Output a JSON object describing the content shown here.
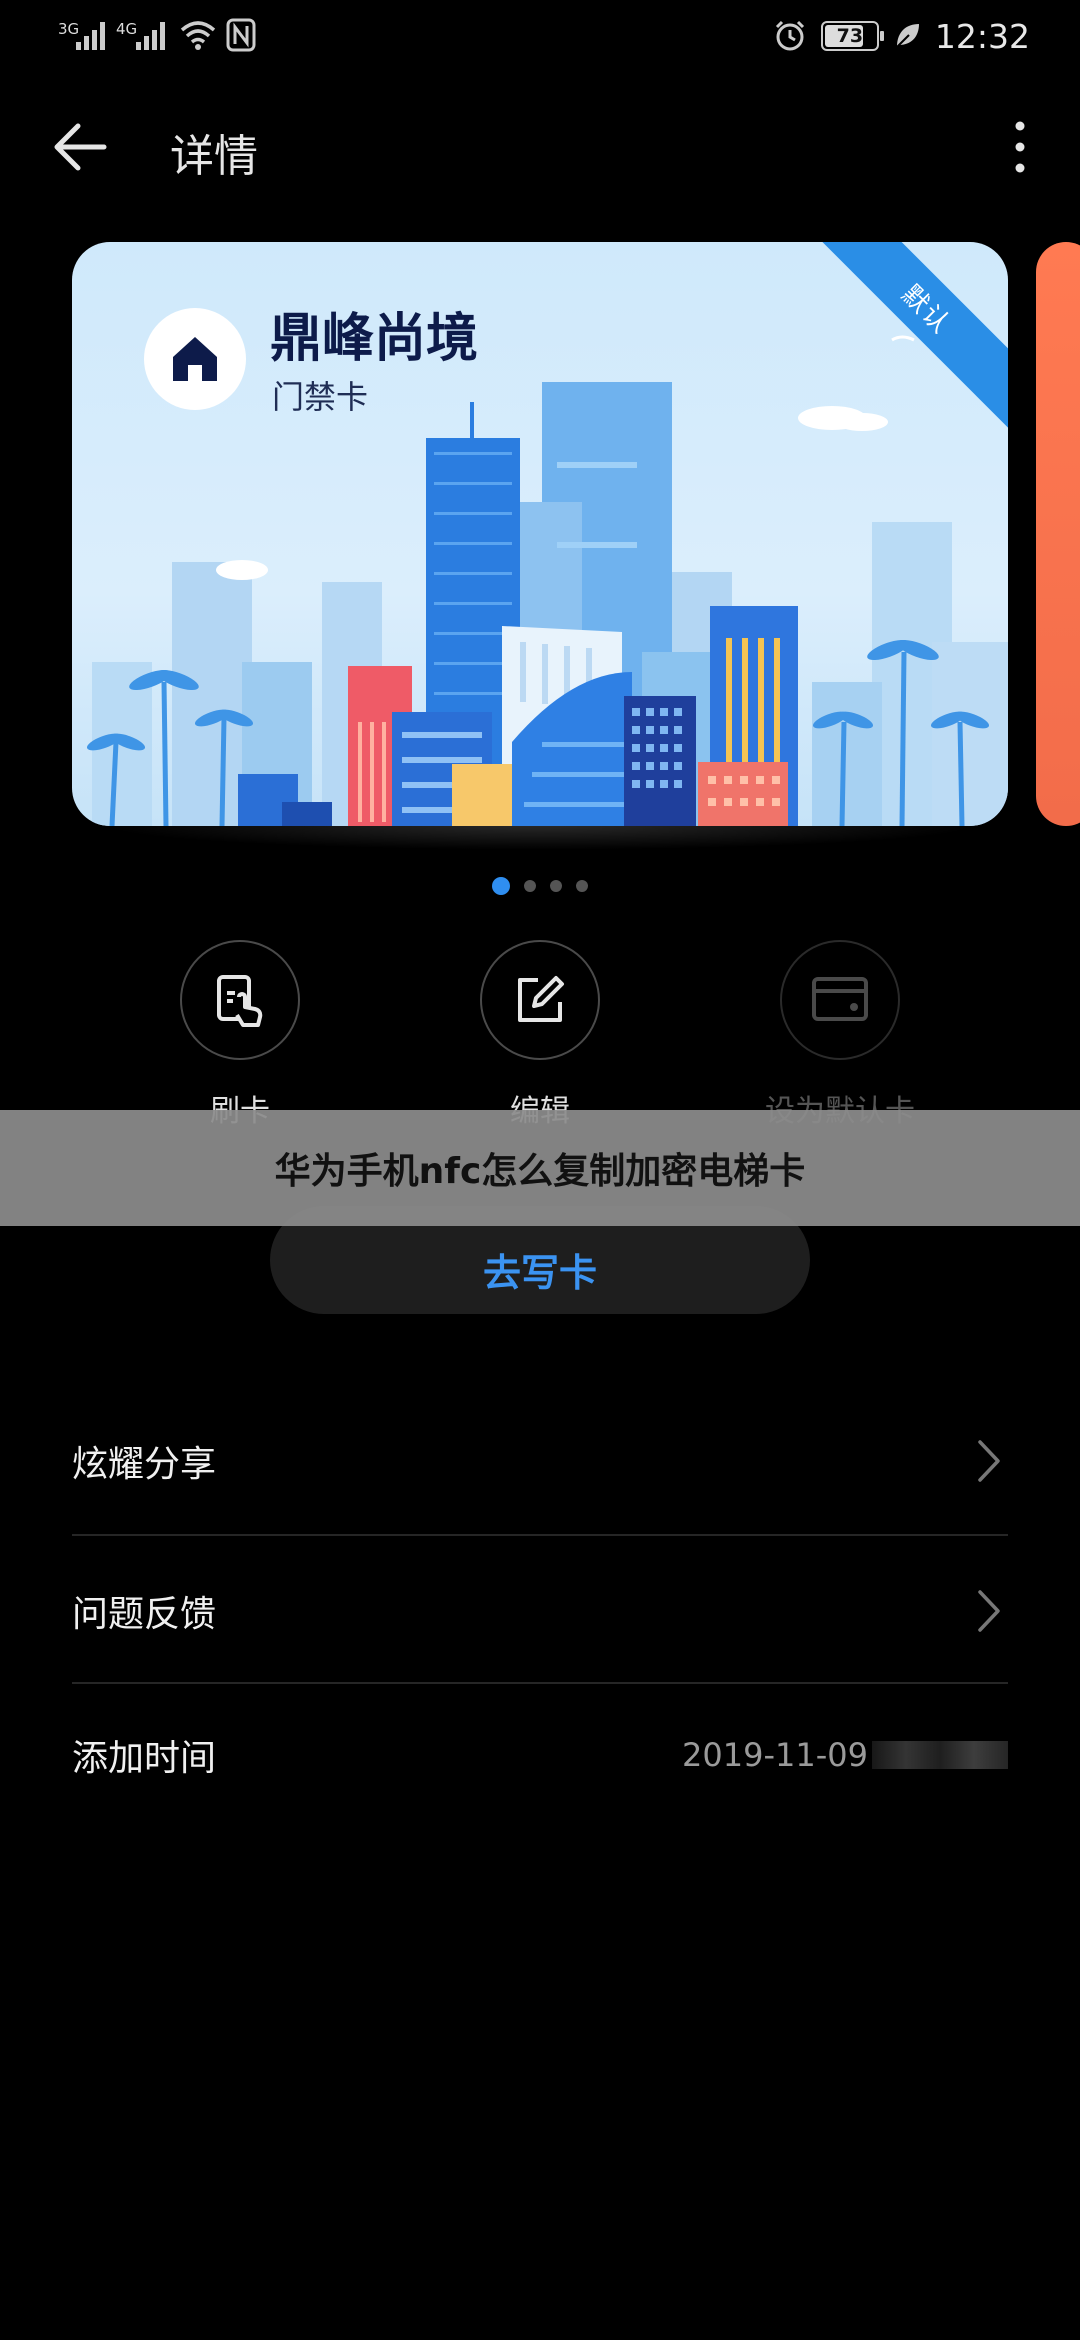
{
  "status_bar": {
    "signal_1": "3G",
    "signal_2": "4G",
    "battery": "73",
    "time": "12:32"
  },
  "app_bar": {
    "title": "详情"
  },
  "card": {
    "title": "鼎峰尚境",
    "subtitle": "门禁卡",
    "ribbon": "默认"
  },
  "pager": {
    "count": 4,
    "active_index": 0
  },
  "actions": [
    {
      "label": "刷卡",
      "icon": "tap-card-icon",
      "enabled": true
    },
    {
      "label": "编辑",
      "icon": "edit-icon",
      "enabled": true
    },
    {
      "label": "设为默认卡",
      "icon": "card-icon",
      "enabled": false
    }
  ],
  "overlay_banner": "华为手机nfc怎么复制加密电梯卡",
  "write_button": "去写卡",
  "list": [
    {
      "label": "炫耀分享",
      "chevron": true
    },
    {
      "label": "问题反馈",
      "chevron": true
    },
    {
      "label": "添加时间",
      "value": "2019-11-09"
    }
  ],
  "colors": {
    "accent": "#2f8ef0",
    "ribbon": "#2a8ee6",
    "card_title": "#0d1b4a",
    "next_card": "#f26c4a"
  }
}
